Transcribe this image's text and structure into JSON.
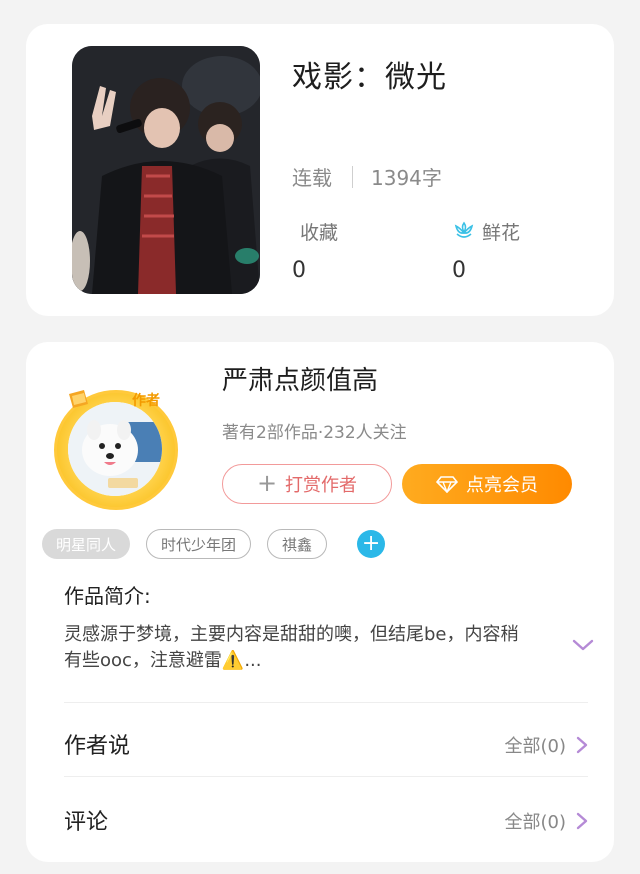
{
  "book": {
    "title": "戏影：微光",
    "status": "连载",
    "word_count": "1394字",
    "favorites_label": "收藏",
    "favorites_count": "0",
    "flowers_label": "鲜花",
    "flowers_count": "0"
  },
  "author": {
    "name": "严肃点颜值高",
    "meta": "著有2部作品·232人关注",
    "badge": "作者",
    "reward_label": "打赏作者",
    "vip_label": "点亮会员"
  },
  "tags": [
    "明星同人",
    "时代少年团",
    "祺鑫"
  ],
  "intro": {
    "title": "作品简介:",
    "text": "灵感源于梦境，主要内容是甜甜的噢，但结尾be，内容稍有些ooc，注意避雷⚠️..."
  },
  "author_says": {
    "label": "作者说",
    "count_label": "全部(0)"
  },
  "comments": {
    "label": "评论",
    "count_label": "全部(0)"
  },
  "colors": {
    "accent_purple": "#b58ad6",
    "vip_orange": "#ff8a00",
    "reward_red": "#e36a6a",
    "tag_add_blue": "#2bb8e8",
    "flower_teal": "#3cc1e6"
  }
}
